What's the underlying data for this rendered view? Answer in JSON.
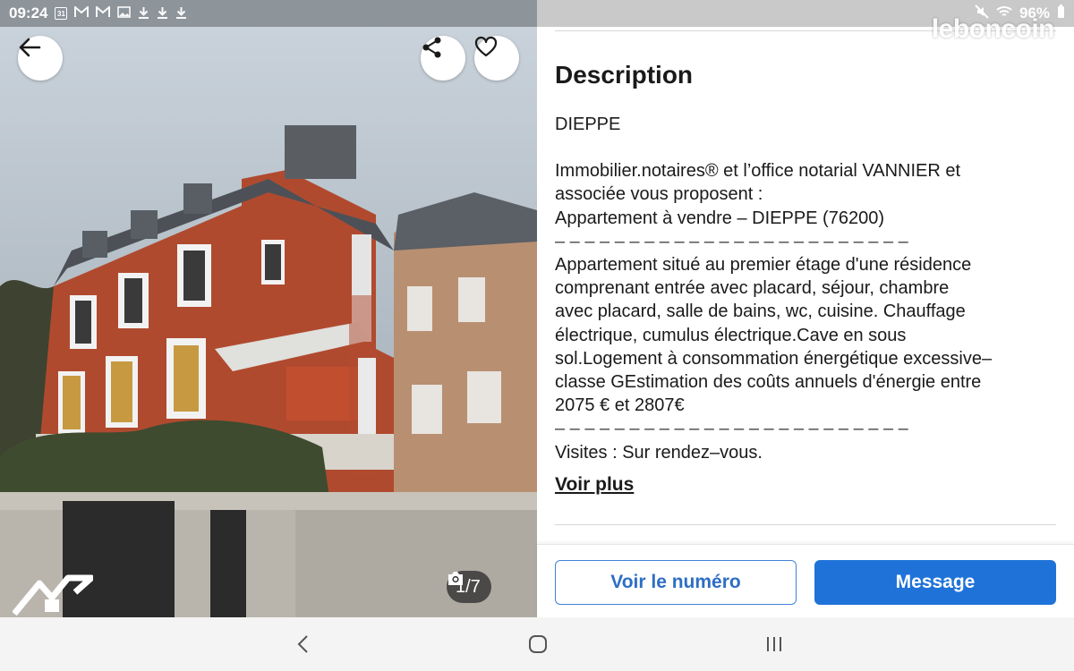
{
  "status_bar": {
    "time": "09:24",
    "calendar_day": "31",
    "battery": "96%",
    "left_icons": [
      "calendar-icon",
      "gmail-icon",
      "gmail-icon",
      "gallery-icon",
      "download-icon",
      "download-icon",
      "download-icon"
    ],
    "right_icons": [
      "mute-icon",
      "wifi-icon",
      "signal-icon",
      "battery-icon"
    ]
  },
  "brand": {
    "watermark": "leboncoin"
  },
  "gallery": {
    "counter": "1/7",
    "buttons": [
      "back-icon",
      "share-icon",
      "heart-icon"
    ]
  },
  "description": {
    "title": "Description",
    "city": "DIEPPE",
    "intro": "Immobilier.notaires® et l’office notarial VANNIER et\nassociée vous proposent :\nAppartement à vendre – DIEPPE (76200)",
    "dashes": "– – – – – – – – – – – – – – – – – – – – – – – –",
    "details": "Appartement situé au premier étage d'une résidence\ncomprenant entrée avec placard, séjour, chambre\navec placard, salle de bains, wc, cuisine. Chauffage\nélectrique, cumulus électrique.Cave en sous\nsol.Logement à consommation énergétique excessive–\nclasse GEstimation  des coûts annuels d'énergie  entre\n2075 € et 2807€",
    "visits": "Visites : Sur rendez–vous.",
    "more_link": "Voir plus"
  },
  "actions": {
    "phone_label": "Voir le numéro",
    "message_label": "Message"
  },
  "colors": {
    "accent_blue": "#1f73d8",
    "outline_blue": "#4183d7",
    "status_bar_left": "#8d949a",
    "status_bar_right": "#c9c9c9"
  },
  "nav_bar": [
    "back-nav-icon",
    "home-nav-icon",
    "recents-nav-icon"
  ]
}
